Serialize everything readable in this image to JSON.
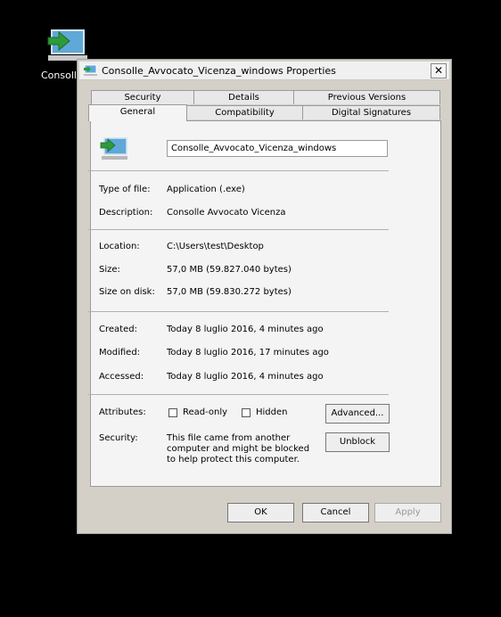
{
  "desktop": {
    "icon_label": "Consoll"
  },
  "dialog": {
    "title": "Consolle_Avvocato_Vicenza_windows Properties",
    "close": "✕",
    "tabs_row1": [
      "Security",
      "Details",
      "Previous Versions"
    ],
    "tabs_row2": [
      "General",
      "Compatibility",
      "Digital Signatures"
    ],
    "active_tab": "General",
    "file_name": "Consolle_Avvocato_Vicenza_windows",
    "fields": {
      "type_label": "Type of file:",
      "type_value": "Application (.exe)",
      "desc_label": "Description:",
      "desc_value": "Consolle Avvocato Vicenza",
      "location_label": "Location:",
      "location_value": "C:\\Users\\test\\Desktop",
      "size_label": "Size:",
      "size_value": "57,0 MB (59.827.040 bytes)",
      "size_disk_label": "Size on disk:",
      "size_disk_value": "57,0 MB (59.830.272 bytes)",
      "created_label": "Created:",
      "created_value": "Today 8 luglio 2016, 4 minutes ago",
      "modified_label": "Modified:",
      "modified_value": "Today 8 luglio 2016, 17 minutes ago",
      "accessed_label": "Accessed:",
      "accessed_value": "Today 8 luglio 2016, 4 minutes ago",
      "attributes_label": "Attributes:",
      "readonly_label": "Read-only",
      "hidden_label": "Hidden",
      "security_label": "Security:",
      "security_text": "This file came from another computer and might be blocked to help protect this computer."
    },
    "buttons": {
      "advanced": "Advanced...",
      "unblock": "Unblock",
      "ok": "OK",
      "cancel": "Cancel",
      "apply": "Apply"
    },
    "checkboxes": {
      "readonly": false,
      "hidden": false
    }
  },
  "colors": {
    "accent_green": "#2e9a3a",
    "monitor_blue": "#5fa8d8",
    "dialog_bg": "#f4f4f4"
  }
}
